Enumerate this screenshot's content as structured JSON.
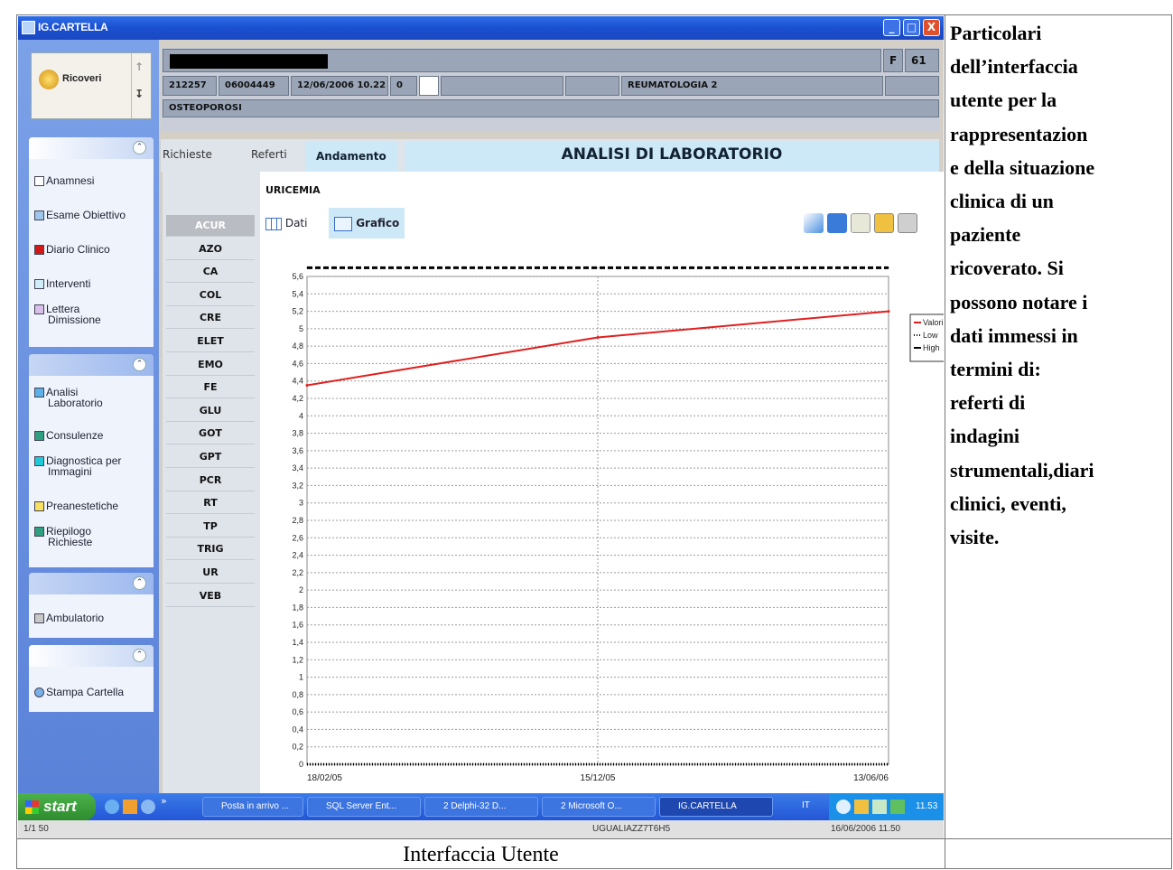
{
  "window": {
    "title": "IG.CARTELLA",
    "buttons": [
      "_",
      "□",
      "X"
    ]
  },
  "nav": {
    "ricoveri_label": "Ricoveri",
    "arrow_up": "↑",
    "arrow_down": "↧",
    "panel_chevron": "⌃",
    "group1": [
      "Anamnesi",
      "Esame Obiettivo",
      "Diario Clinico",
      "Interventi",
      "Lettera Dimissione"
    ],
    "group2": [
      "Analisi Laboratorio",
      "Consulenze",
      "Diagnostica per Immagini",
      "Preanestetiche",
      "Riepilogo Richieste"
    ],
    "group3": [
      "Ambulatorio"
    ],
    "group4": [
      "Stampa Cartella"
    ],
    "group1_colors": [
      "#ffffff",
      "#9ec6ea",
      "#d01818",
      "#cfeefa",
      "#d8c0ea"
    ],
    "group2_colors": [
      "#5ab0e8",
      "#2ea080",
      "#20c8d8",
      "#f8e060",
      "#2ea080"
    ],
    "group3_colors": [
      "#c8c8c8"
    ]
  },
  "patient": {
    "sex": "F",
    "age": "61",
    "id1": "212257",
    "id2": "06004449",
    "datetime": "12/06/2006 10.22",
    "count": "0",
    "ward": "REUMATOLOGIA 2",
    "diagnosis": "OSTEOPOROSI"
  },
  "tabs": {
    "richieste": "Richieste",
    "referti": "Referti",
    "andamento": "Andamento",
    "section_title": "ANALISI DI LABORATORIO"
  },
  "analyses": {
    "selected": "ACUR",
    "items": [
      "ACUR",
      "AZO",
      "CA",
      "COL",
      "CRE",
      "ELET",
      "EMO",
      "FE",
      "GLU",
      "GOT",
      "GPT",
      "PCR",
      "RT",
      "TP",
      "TRIG",
      "UR",
      "VEB"
    ]
  },
  "panel": {
    "exam_title": "URICEMIA",
    "dati_label": "Dati",
    "grafico_label": "Grafico"
  },
  "chart_data": {
    "type": "line",
    "title": "",
    "xlabel": "",
    "ylabel": "",
    "x": [
      "18/02/05",
      "15/12/05",
      "13/06/06"
    ],
    "ylim": [
      0,
      5.8
    ],
    "yticks": [
      "0",
      "0,2",
      "0,4",
      "0,6",
      "0,8",
      "1",
      "1,2",
      "1,4",
      "1,6",
      "1,8",
      "2",
      "2,2",
      "2,4",
      "2,6",
      "2,8",
      "3",
      "3,2",
      "3,4",
      "3,6",
      "3,8",
      "4",
      "4,2",
      "4,4",
      "4,6",
      "4,8",
      "5",
      "5,2",
      "5,4",
      "5,6"
    ],
    "grid": true,
    "legend_position": "right",
    "series": [
      {
        "name": "Valori",
        "values": [
          4.35,
          4.9,
          5.2
        ],
        "color": "#e02020",
        "style": "solid"
      },
      {
        "name": "Low",
        "values": [
          0,
          0,
          0
        ],
        "color": "#000000",
        "style": "dotted"
      },
      {
        "name": "High",
        "values": [
          5.7,
          5.7,
          5.7
        ],
        "color": "#000000",
        "style": "dashed"
      }
    ]
  },
  "taskbar": {
    "start": "start",
    "chevron": "»",
    "items": [
      "Posta in arrivo ...",
      "SQL Server Ent...",
      "2 Delphi-32 D...",
      "2 Microsoft O...",
      "IG.CARTELLA"
    ],
    "lang": "IT",
    "clock": "11.53"
  },
  "status": {
    "left": "1/1 50",
    "mid": "UGUALIAZZ7T6H5",
    "right": "16/06/2006 11.50"
  },
  "side_text": [
    "Particolari",
    "dell’interfaccia",
    "utente per la",
    "rappresentazion",
    "e della situazione",
    "clinica di un",
    "paziente",
    "ricoverato. Si",
    "possono notare i",
    "dati immessi in",
    "termini di:",
    "referti di",
    "indagini",
    "strumentali,diari",
    "clinici, eventi,",
    "visite."
  ],
  "caption": "Interfaccia Utente"
}
